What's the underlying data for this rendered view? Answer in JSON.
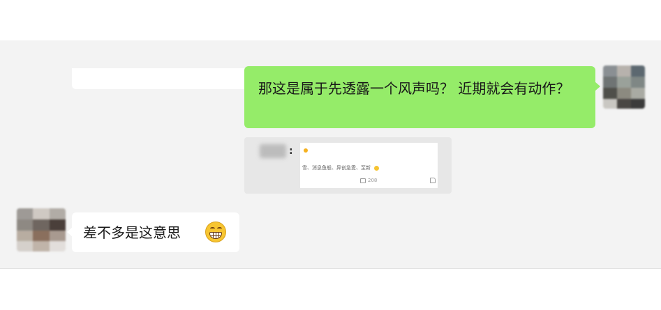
{
  "conversation": {
    "messages": [
      {
        "side": "right",
        "sender": "self",
        "text": "那这是属于先透露一个风声吗？ 近期就会有动作？",
        "bubble_color": "#95ec69"
      },
      {
        "side": "left",
        "sender": "contact",
        "text": "差不多是这意思",
        "emoji": "grinning-face-icon",
        "bubble_color": "#ffffff"
      }
    ],
    "quote": {
      "colon": ":",
      "card_text": "雪、消息鱼般、异创急愛、至新",
      "card_stat": "208"
    }
  },
  "colors": {
    "chat_background": "#f3f3f3",
    "self_bubble": "#95ec69",
    "contact_bubble": "#ffffff",
    "quote_background": "#e7e7e7"
  }
}
